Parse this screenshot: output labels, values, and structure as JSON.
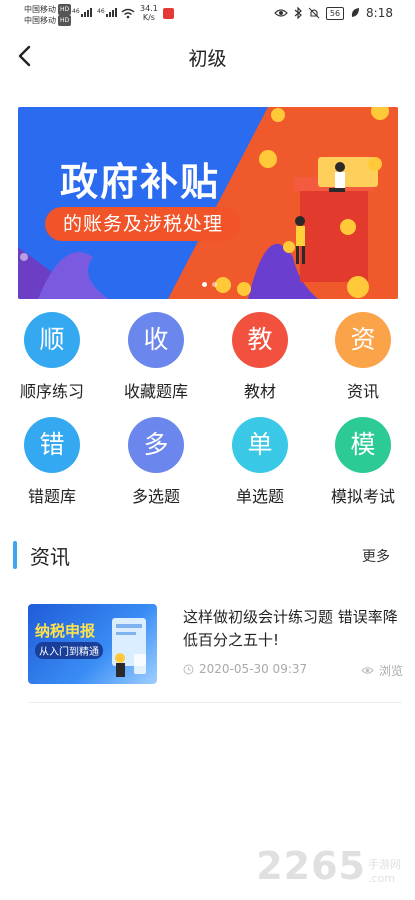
{
  "status_bar": {
    "carrier_1": "中国移动",
    "carrier_2": "中国移动",
    "hd_badge": "HD",
    "network_1": "46",
    "network_2": "46",
    "speed_value": "34.1",
    "speed_unit": "K/s",
    "battery": "56",
    "time": "8:18"
  },
  "header": {
    "title": "初级"
  },
  "banner": {
    "title": "政府补贴",
    "subtitle": "的账务及涉税处理",
    "page_dots": 2,
    "active_dot": 0
  },
  "grid": {
    "items": [
      {
        "glyph": "顺",
        "label": "顺序练习",
        "color": "#35a8f2"
      },
      {
        "glyph": "收",
        "label": "收藏题库",
        "color": "#6b86ec"
      },
      {
        "glyph": "教",
        "label": "教材",
        "color": "#f2513f"
      },
      {
        "glyph": "资",
        "label": "资讯",
        "color": "#fba349"
      },
      {
        "glyph": "错",
        "label": "错题库",
        "color": "#35a8f2"
      },
      {
        "glyph": "多",
        "label": "多选题",
        "color": "#6b86ec"
      },
      {
        "glyph": "单",
        "label": "单选题",
        "color": "#39c9e6"
      },
      {
        "glyph": "模",
        "label": "模拟考试",
        "color": "#2ccb96"
      }
    ]
  },
  "news": {
    "section_title": "资讯",
    "more_label": "更多",
    "items": [
      {
        "thumb_title": "纳税申报",
        "thumb_subtitle": "从入门到精通",
        "title": "这样做初级会计练习题 错误率降低百分之五十!",
        "date": "2020-05-30 09:37",
        "views_label": "浏览"
      }
    ]
  },
  "watermark": {
    "number": "2265",
    "site": "手游网",
    "domain": ".com"
  },
  "colors": {
    "accent": "#3ea5ee",
    "banner_blue": "#2b6bf0",
    "banner_red": "#f05428"
  },
  "icons": {
    "back": "chevron-left-icon",
    "date": "clock-icon",
    "views": "eye-icon"
  }
}
